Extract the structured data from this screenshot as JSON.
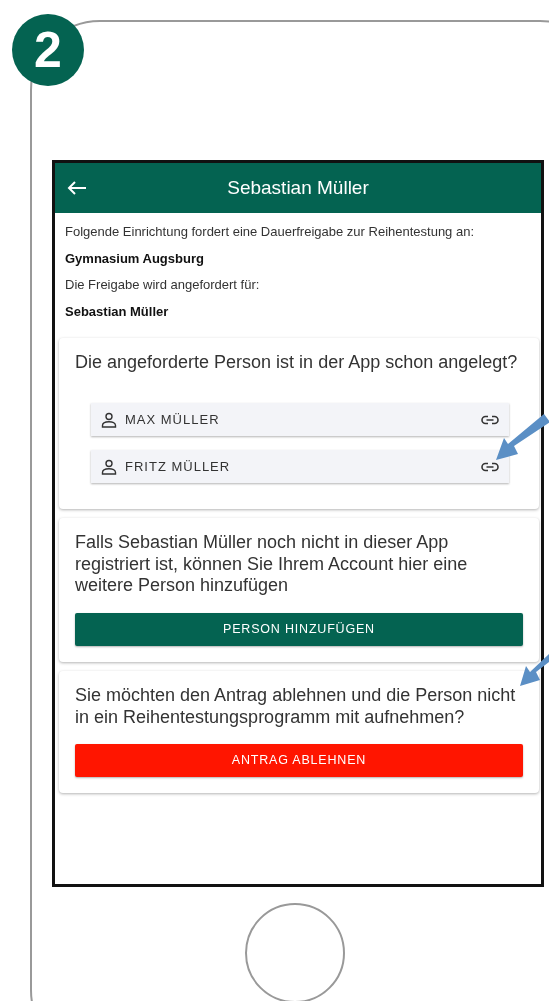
{
  "step": "2",
  "header": {
    "title": "Sebastian Müller"
  },
  "intro": {
    "text": "Folgende Einrichtung fordert eine Dauerfreigabe zur Reihentestung an:",
    "institution": "Gymnasium Augsburg",
    "request_label": "Die Freigabe wird angefordert für:",
    "person": "Sebastian Müller"
  },
  "link_card": {
    "question": "Die angeforderte Person ist in der App schon angelegt?",
    "persons": [
      {
        "name": "MAX MÜLLER"
      },
      {
        "name": "FRITZ MÜLLER"
      }
    ]
  },
  "add_card": {
    "text": "Falls Sebastian Müller noch nicht in dieser App registriert ist, können Sie Ihrem Account hier eine weitere Person hinzufügen",
    "button": "PERSON HINZUFÜGEN"
  },
  "reject_card": {
    "text": "Sie möchten den Antrag ablehnen und die Person nicht in ein Reihentestungsprogramm mit aufnehmen?",
    "button": "ANTRAG ABLEHNEN"
  }
}
